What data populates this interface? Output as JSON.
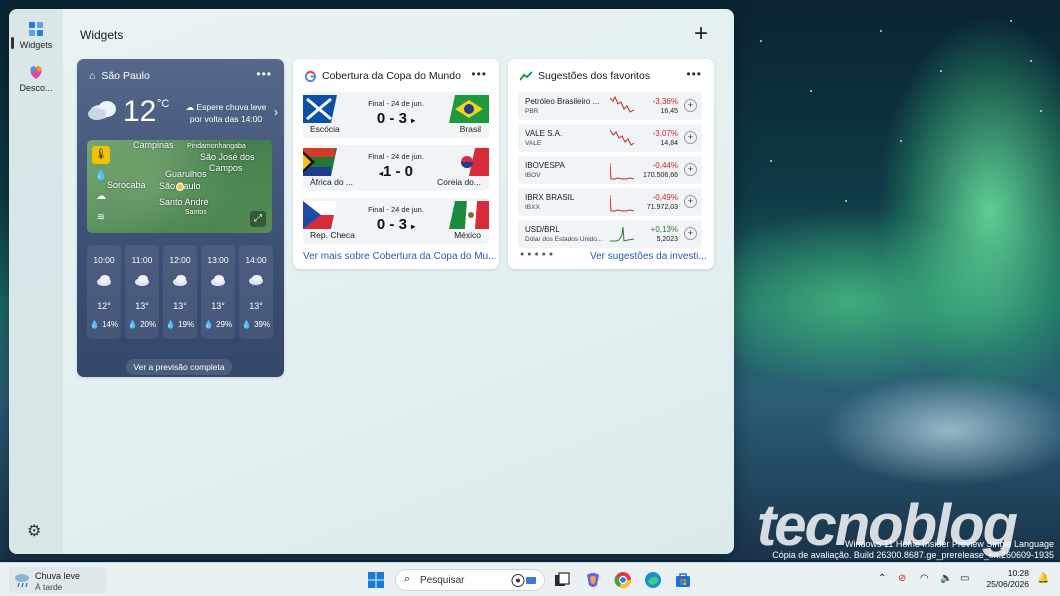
{
  "desktop": {
    "watermark": "tecnoblog",
    "build_line1": "Windows 11 Home Insider Preview Single Language",
    "build_line2": "Cópia de avaliação. Build 26300.8687.ge_prerelease_im.260609-1935"
  },
  "board": {
    "title": "Widgets",
    "rail": [
      {
        "label": "Widgets",
        "icon": "widgets-icon"
      },
      {
        "label": "Desco...",
        "icon": "discover-icon"
      }
    ]
  },
  "weather": {
    "city": "São Paulo",
    "temp": "12",
    "unit": "°C",
    "note": "Espere chuva leve por volta das 14:00",
    "map_labels": [
      "Campinas",
      "Pindamonhangaba",
      "São José dos",
      "Campos",
      "Guarulhos",
      "Sorocaba",
      "São Paulo",
      "Santo André",
      "Santos"
    ],
    "hourly": [
      {
        "time": "10:00",
        "temp": "12°",
        "precip": "14%"
      },
      {
        "time": "11:00",
        "temp": "13°",
        "precip": "20%"
      },
      {
        "time": "12:00",
        "temp": "13°",
        "precip": "19%"
      },
      {
        "time": "13:00",
        "temp": "13°",
        "precip": "29%"
      },
      {
        "time": "14:00",
        "temp": "13°",
        "precip": "39%"
      }
    ],
    "forecast_link": "Ver a previsão completa"
  },
  "cup": {
    "title": "Cobertura da Copa do Mundo",
    "matches": [
      {
        "home": "Escócia",
        "away": "Brasil",
        "status": "Final - 24 de jun.",
        "score": "0 - 3"
      },
      {
        "home": "África do ...",
        "away": "Coreia do...",
        "status": "Final - 24 de jun.",
        "score": "1 - 0"
      },
      {
        "home": "Rep. Checa",
        "away": "México",
        "status": "Final - 24 de jun.",
        "score": "0 - 3"
      }
    ],
    "link": "Ver mais sobre Cobertura da Copa do Mu..."
  },
  "stocks": {
    "title": "Sugestões dos favoritos",
    "rows": [
      {
        "name": "Petróleo Brasileiro ...",
        "symbol": "PBR",
        "change": "-3,36%",
        "value": "16,45",
        "dir": "down"
      },
      {
        "name": "VALE S.A.",
        "symbol": "VALE",
        "change": "-3,07%",
        "value": "14,84",
        "dir": "down"
      },
      {
        "name": "IBOVESPA",
        "symbol": "IBOV",
        "change": "-0,44%",
        "value": "170.506,66",
        "dir": "down"
      },
      {
        "name": "IBRX BRASIL",
        "symbol": "IBXX",
        "change": "-0,49%",
        "value": "71.972,03",
        "dir": "down"
      },
      {
        "name": "USD/BRL",
        "symbol": "Dólar dos Estados Unido...",
        "change": "+0,13%",
        "value": "5,2023",
        "dir": "up"
      }
    ],
    "link": "Ver sugestões da investi..."
  },
  "taskbar": {
    "weather_title": "Chuva leve",
    "weather_sub": "À tarde",
    "search_placeholder": "Pesquisar",
    "time": "10:28",
    "date": "25/06/2026"
  }
}
